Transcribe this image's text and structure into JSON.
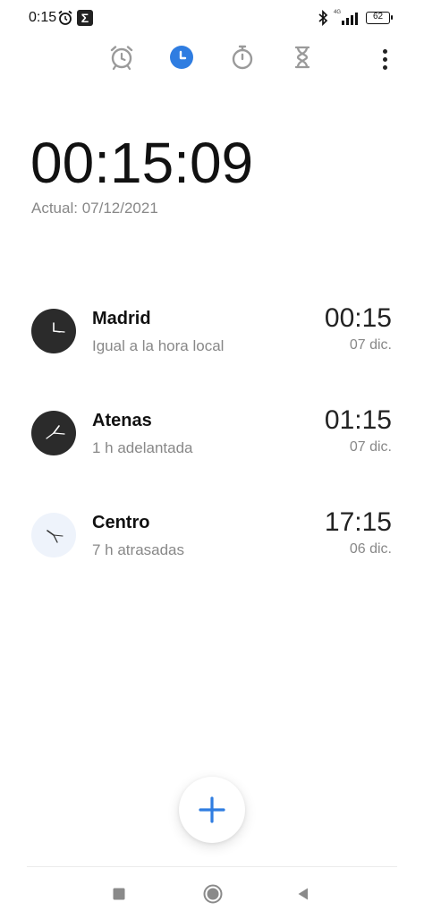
{
  "status_bar": {
    "time": "0:15",
    "network": "4G",
    "battery": "62"
  },
  "tabs": [
    {
      "name": "alarm",
      "icon": "alarm-clock-icon",
      "active": false
    },
    {
      "name": "clock",
      "icon": "clock-icon",
      "active": true
    },
    {
      "name": "stopwatch",
      "icon": "stopwatch-icon",
      "active": false
    },
    {
      "name": "timer",
      "icon": "hourglass-icon",
      "active": false
    }
  ],
  "current": {
    "time": "00:15:09",
    "date": "Actual: 07/12/2021"
  },
  "world_clocks": [
    {
      "city": "Madrid",
      "offset": "Igual a la hora local",
      "time": "00:15",
      "date": "07 dic.",
      "theme": "dark"
    },
    {
      "city": "Atenas",
      "offset": "1 h adelantada",
      "time": "01:15",
      "date": "07 dic.",
      "theme": "dark"
    },
    {
      "city": "Centro",
      "offset": "7 h atrasadas",
      "time": "17:15",
      "date": "06 dic.",
      "theme": "light"
    }
  ],
  "colors": {
    "accent": "#2f7de1",
    "icon_gray": "#9a9a9a",
    "dark_face": "#2b2b2b",
    "light_face": "#eef3fb"
  }
}
